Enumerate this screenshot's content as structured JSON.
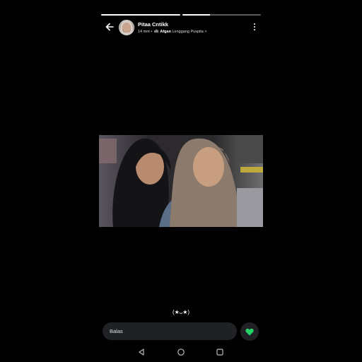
{
  "story": {
    "progress": [
      1.0,
      0.35
    ],
    "user_name": "Pitaa Cntikk",
    "time_ago": "14 mnt",
    "separator": "•",
    "music_artist": "Afgan",
    "music_title": "Lenggang Puspita",
    "music_chevron": ">",
    "caption": "(★ᴗ★)"
  },
  "reply": {
    "placeholder": "Balas"
  },
  "colors": {
    "like": "#25d366",
    "background": "#000000",
    "input_bg": "#1f2124"
  },
  "icons": {
    "back": "arrow-left-icon",
    "more": "more-vert-icon",
    "music": "music-icon",
    "like": "heart-icon",
    "nav_back": "triangle-back-icon",
    "nav_home": "circle-home-icon",
    "nav_recents": "square-recents-icon"
  }
}
